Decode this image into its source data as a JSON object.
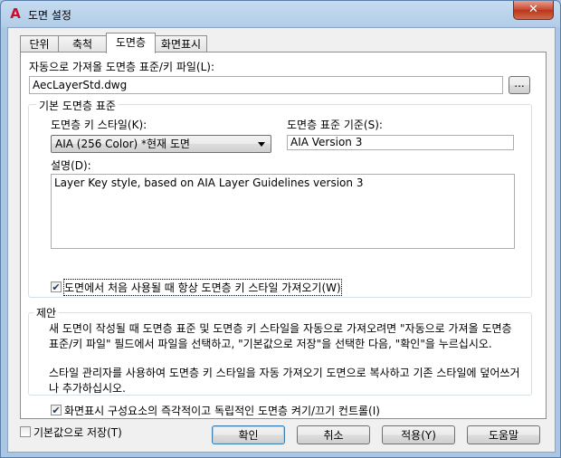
{
  "window": {
    "title": "도면 설정",
    "close_glyph": "✕",
    "app_icon_glyph": "A"
  },
  "tabs": [
    {
      "label": "단위"
    },
    {
      "label": "축척"
    },
    {
      "label": "도면층"
    },
    {
      "label": "화면표시"
    }
  ],
  "auto_import": {
    "label": "자동으로 가져올 도면층 표준/키 파일(L):",
    "value": "AecLayerStd.dwg",
    "browse_label": "..."
  },
  "default_layer": {
    "legend": "기본 도면층 표준",
    "key_style_label": "도면층 키 스타일(K):",
    "key_style_value": "AIA (256 Color) *현재 도면",
    "standard_label": "도면층 표준 기준(S):",
    "standard_value": "AIA Version 3",
    "description_label": "설명(D):",
    "description_value": "Layer Key style, based on AIA Layer Guidelines version 3",
    "always_import_label": "도면에서 처음 사용될 때 항상 도면층 키 스타일 가져오기(W)",
    "always_import_checked": true
  },
  "suggestion": {
    "legend": "제안",
    "text1": "새 도면이 작성될 때 도면층 표준 및 도면층 키 스타일을 자동으로 가져오려면 \"자동으로 가져올 도면층 표준/키 파일\" 필드에서 파일을 선택하고, \"기본값으로 저장\"을 선택한 다음, \"확인\"을 누르십시오.",
    "text2": "스타일 관리자를 사용하여 도면층 키 스타일을 자동 가져오기 도면으로 복사하고 기존 스타일에 덮어쓰거나 추가하십시오."
  },
  "display_control": {
    "label": "화면표시 구성요소의 즉각적이고 독립적인 도면층 켜기/끄기 컨트롤(I)",
    "checked": true
  },
  "footer": {
    "save_default_label": "기본값으로 저장(T)",
    "save_default_checked": false,
    "ok_label": "확인",
    "cancel_label": "취소",
    "apply_label": "적용(Y)",
    "help_label": "도움말"
  },
  "colors": {
    "window_frame": "#a9c7e3",
    "close_button": "#c7452b",
    "app_icon": "#c8102e"
  }
}
